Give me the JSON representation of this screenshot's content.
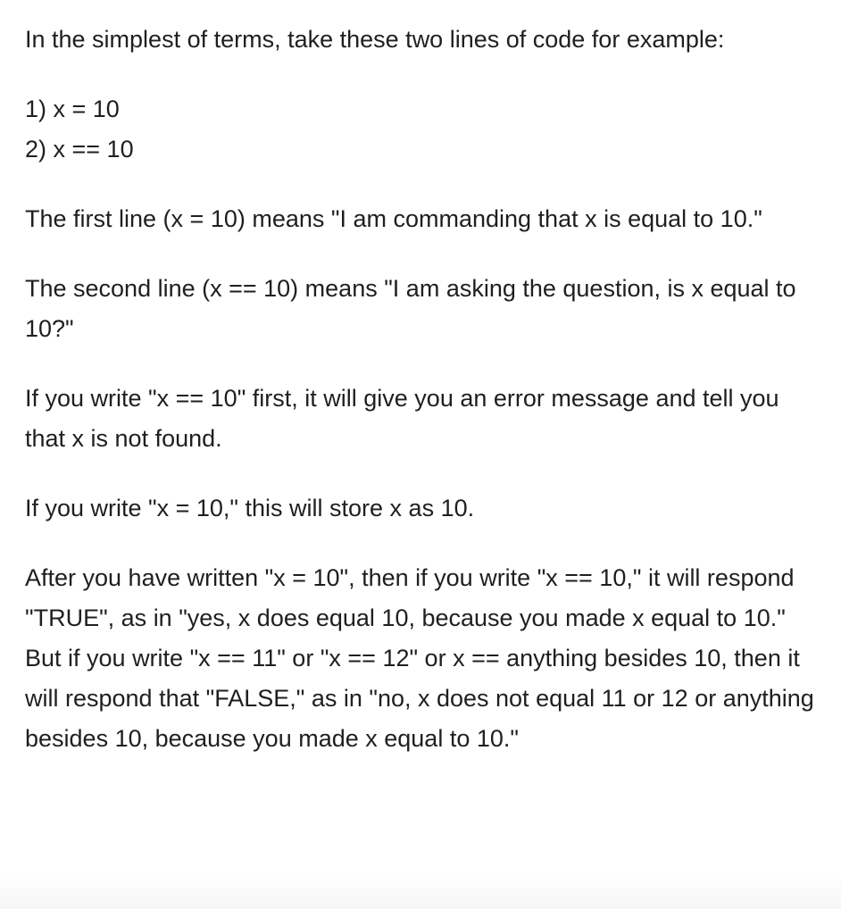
{
  "answer": {
    "intro": "In the simplest of terms, take these two lines of code for example:",
    "code_lines": [
      "1) x = 10",
      "2) x == 10"
    ],
    "first_line_explanation": "The first line (x = 10) means \"I am commanding that x is equal to 10.\"",
    "second_line_explanation": "The second line (x == 10) means \"I am asking the question, is x equal to 10?\"",
    "error_note": "If you write \"x == 10\" first, it will give you an error message and tell you that x is not found.",
    "store_note": "If you write \"x = 10,\" this will store x as 10.",
    "conclusion": "After you have written \"x = 10\", then if you write \"x == 10,\" it will respond \"TRUE\", as in \"yes, x does equal 10, because you made x equal to 10.\" But if you write \"x == 11\" or \"x == 12\" or x == anything besides 10, then it will respond that \"FALSE,\" as in \"no, x does not equal 11 or 12 or anything besides 10, because you made x equal to 10.\""
  }
}
